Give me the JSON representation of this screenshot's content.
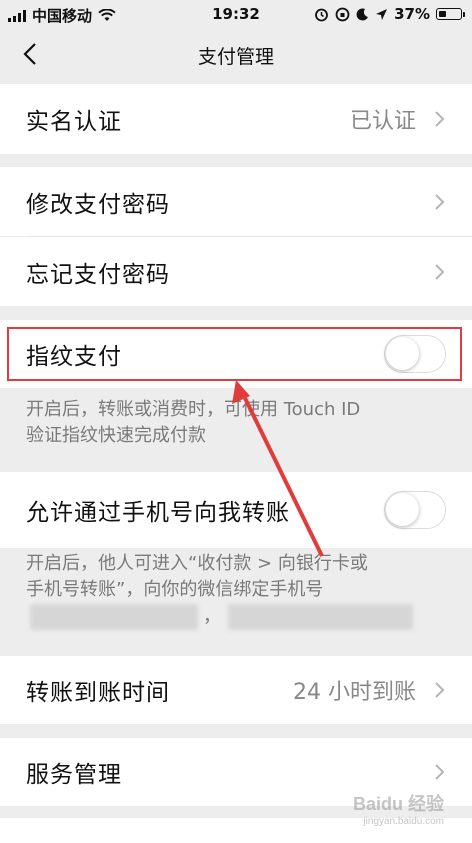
{
  "status_bar": {
    "carrier": "中国移动",
    "time": "19:32",
    "battery": "37%",
    "battery_level": 0.37
  },
  "nav": {
    "title": "支付管理"
  },
  "rows": {
    "real_name": {
      "label": "实名认证",
      "value": "已认证"
    },
    "change_password": {
      "label": "修改支付密码"
    },
    "forgot_password": {
      "label": "忘记支付密码"
    },
    "fingerprint": {
      "label": "指纹支付",
      "enabled": false
    },
    "fingerprint_hint_line1": "开启后，转账或消费时，可使用 Touch ID",
    "fingerprint_hint_line2": "验证指纹快速完成付款",
    "phone_transfer": {
      "label": "允许通过手机号向我转账",
      "enabled": false
    },
    "phone_hint_line1": "开启后，他人可进入“收付款 > 向银行卡或",
    "phone_hint_line2": "手机号转账”，向你的微信绑定手机号",
    "phone_hint_sep": "，",
    "arrival_time": {
      "label": "转账到账时间",
      "value": "24 小时到账"
    },
    "service": {
      "label": "服务管理"
    }
  },
  "watermark": {
    "text": "Baidu 经验",
    "sub": "jingyan.baidu.com"
  },
  "colors": {
    "background": "#ededed",
    "highlight": "#e23b3b",
    "secondary_text": "#888888"
  }
}
